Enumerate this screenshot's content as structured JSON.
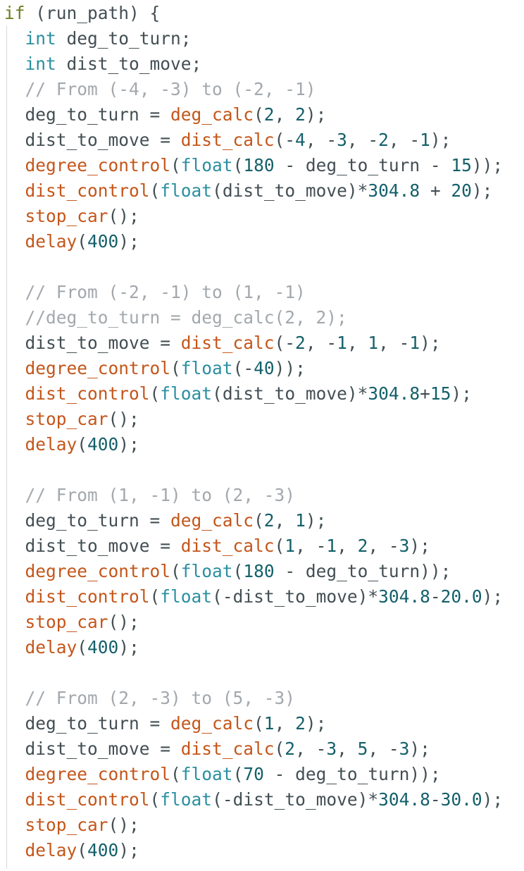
{
  "colors": {
    "keyword": "#6f7a1e",
    "type": "#2a8fa0",
    "function": "#c4561a",
    "number": "#14606a",
    "comment": "#a3a8ad",
    "identifier": "#434f54",
    "background": "#ffffff"
  },
  "lines": [
    {
      "tokens": [
        {
          "t": "if",
          "c": "kw"
        },
        {
          "t": " (run_path) {",
          "c": "id"
        }
      ]
    },
    {
      "tokens": [
        {
          "t": "  ",
          "c": "id"
        },
        {
          "t": "int",
          "c": "type"
        },
        {
          "t": " deg_to_turn;",
          "c": "id"
        }
      ]
    },
    {
      "tokens": [
        {
          "t": "  ",
          "c": "id"
        },
        {
          "t": "int",
          "c": "type"
        },
        {
          "t": " dist_to_move;",
          "c": "id"
        }
      ]
    },
    {
      "tokens": [
        {
          "t": "  // From (-4, -3) to (-2, -1)",
          "c": "cmt"
        }
      ]
    },
    {
      "tokens": [
        {
          "t": "  deg_to_turn = ",
          "c": "id"
        },
        {
          "t": "deg_calc",
          "c": "fn"
        },
        {
          "t": "(",
          "c": "id"
        },
        {
          "t": "2",
          "c": "num"
        },
        {
          "t": ", ",
          "c": "id"
        },
        {
          "t": "2",
          "c": "num"
        },
        {
          "t": ");",
          "c": "id"
        }
      ]
    },
    {
      "tokens": [
        {
          "t": "  dist_to_move = ",
          "c": "id"
        },
        {
          "t": "dist_calc",
          "c": "fn"
        },
        {
          "t": "(-",
          "c": "id"
        },
        {
          "t": "4",
          "c": "num"
        },
        {
          "t": ", -",
          "c": "id"
        },
        {
          "t": "3",
          "c": "num"
        },
        {
          "t": ", -",
          "c": "id"
        },
        {
          "t": "2",
          "c": "num"
        },
        {
          "t": ", -",
          "c": "id"
        },
        {
          "t": "1",
          "c": "num"
        },
        {
          "t": ");",
          "c": "id"
        }
      ]
    },
    {
      "tokens": [
        {
          "t": "  ",
          "c": "id"
        },
        {
          "t": "degree_control",
          "c": "fn"
        },
        {
          "t": "(",
          "c": "id"
        },
        {
          "t": "float",
          "c": "type"
        },
        {
          "t": "(",
          "c": "id"
        },
        {
          "t": "180",
          "c": "num"
        },
        {
          "t": " - deg_to_turn - ",
          "c": "id"
        },
        {
          "t": "15",
          "c": "num"
        },
        {
          "t": "));",
          "c": "id"
        }
      ]
    },
    {
      "tokens": [
        {
          "t": "  ",
          "c": "id"
        },
        {
          "t": "dist_control",
          "c": "fn"
        },
        {
          "t": "(",
          "c": "id"
        },
        {
          "t": "float",
          "c": "type"
        },
        {
          "t": "(dist_to_move)*",
          "c": "id"
        },
        {
          "t": "304.8",
          "c": "num"
        },
        {
          "t": " + ",
          "c": "id"
        },
        {
          "t": "20",
          "c": "num"
        },
        {
          "t": ");",
          "c": "id"
        }
      ]
    },
    {
      "tokens": [
        {
          "t": "  ",
          "c": "id"
        },
        {
          "t": "stop_car",
          "c": "fn"
        },
        {
          "t": "();",
          "c": "id"
        }
      ]
    },
    {
      "tokens": [
        {
          "t": "  ",
          "c": "id"
        },
        {
          "t": "delay",
          "c": "fn"
        },
        {
          "t": "(",
          "c": "id"
        },
        {
          "t": "400",
          "c": "num"
        },
        {
          "t": ");",
          "c": "id"
        }
      ]
    },
    {
      "tokens": []
    },
    {
      "tokens": [
        {
          "t": "  // From (-2, -1) to (1, -1)",
          "c": "cmt"
        }
      ]
    },
    {
      "tokens": [
        {
          "t": "  //deg_to_turn = deg_calc(2, 2);",
          "c": "cmt"
        }
      ]
    },
    {
      "tokens": [
        {
          "t": "  dist_to_move = ",
          "c": "id"
        },
        {
          "t": "dist_calc",
          "c": "fn"
        },
        {
          "t": "(-",
          "c": "id"
        },
        {
          "t": "2",
          "c": "num"
        },
        {
          "t": ", -",
          "c": "id"
        },
        {
          "t": "1",
          "c": "num"
        },
        {
          "t": ", ",
          "c": "id"
        },
        {
          "t": "1",
          "c": "num"
        },
        {
          "t": ", -",
          "c": "id"
        },
        {
          "t": "1",
          "c": "num"
        },
        {
          "t": ");",
          "c": "id"
        }
      ]
    },
    {
      "tokens": [
        {
          "t": "  ",
          "c": "id"
        },
        {
          "t": "degree_control",
          "c": "fn"
        },
        {
          "t": "(",
          "c": "id"
        },
        {
          "t": "float",
          "c": "type"
        },
        {
          "t": "(-",
          "c": "id"
        },
        {
          "t": "40",
          "c": "num"
        },
        {
          "t": "));",
          "c": "id"
        }
      ]
    },
    {
      "tokens": [
        {
          "t": "  ",
          "c": "id"
        },
        {
          "t": "dist_control",
          "c": "fn"
        },
        {
          "t": "(",
          "c": "id"
        },
        {
          "t": "float",
          "c": "type"
        },
        {
          "t": "(dist_to_move)*",
          "c": "id"
        },
        {
          "t": "304.8",
          "c": "num"
        },
        {
          "t": "+",
          "c": "id"
        },
        {
          "t": "15",
          "c": "num"
        },
        {
          "t": ");",
          "c": "id"
        }
      ]
    },
    {
      "tokens": [
        {
          "t": "  ",
          "c": "id"
        },
        {
          "t": "stop_car",
          "c": "fn"
        },
        {
          "t": "();",
          "c": "id"
        }
      ]
    },
    {
      "tokens": [
        {
          "t": "  ",
          "c": "id"
        },
        {
          "t": "delay",
          "c": "fn"
        },
        {
          "t": "(",
          "c": "id"
        },
        {
          "t": "400",
          "c": "num"
        },
        {
          "t": ");",
          "c": "id"
        }
      ]
    },
    {
      "tokens": []
    },
    {
      "tokens": [
        {
          "t": "  // From (1, -1) to (2, -3)",
          "c": "cmt"
        }
      ]
    },
    {
      "tokens": [
        {
          "t": "  deg_to_turn = ",
          "c": "id"
        },
        {
          "t": "deg_calc",
          "c": "fn"
        },
        {
          "t": "(",
          "c": "id"
        },
        {
          "t": "2",
          "c": "num"
        },
        {
          "t": ", ",
          "c": "id"
        },
        {
          "t": "1",
          "c": "num"
        },
        {
          "t": ");",
          "c": "id"
        }
      ]
    },
    {
      "tokens": [
        {
          "t": "  dist_to_move = ",
          "c": "id"
        },
        {
          "t": "dist_calc",
          "c": "fn"
        },
        {
          "t": "(",
          "c": "id"
        },
        {
          "t": "1",
          "c": "num"
        },
        {
          "t": ", -",
          "c": "id"
        },
        {
          "t": "1",
          "c": "num"
        },
        {
          "t": ", ",
          "c": "id"
        },
        {
          "t": "2",
          "c": "num"
        },
        {
          "t": ", -",
          "c": "id"
        },
        {
          "t": "3",
          "c": "num"
        },
        {
          "t": ");",
          "c": "id"
        }
      ]
    },
    {
      "tokens": [
        {
          "t": "  ",
          "c": "id"
        },
        {
          "t": "degree_control",
          "c": "fn"
        },
        {
          "t": "(",
          "c": "id"
        },
        {
          "t": "float",
          "c": "type"
        },
        {
          "t": "(",
          "c": "id"
        },
        {
          "t": "180",
          "c": "num"
        },
        {
          "t": " - deg_to_turn));",
          "c": "id"
        }
      ]
    },
    {
      "tokens": [
        {
          "t": "  ",
          "c": "id"
        },
        {
          "t": "dist_control",
          "c": "fn"
        },
        {
          "t": "(",
          "c": "id"
        },
        {
          "t": "float",
          "c": "type"
        },
        {
          "t": "(-dist_to_move)*",
          "c": "id"
        },
        {
          "t": "304.8",
          "c": "num"
        },
        {
          "t": "-",
          "c": "id"
        },
        {
          "t": "20.0",
          "c": "num"
        },
        {
          "t": ");",
          "c": "id"
        }
      ]
    },
    {
      "tokens": [
        {
          "t": "  ",
          "c": "id"
        },
        {
          "t": "stop_car",
          "c": "fn"
        },
        {
          "t": "();",
          "c": "id"
        }
      ]
    },
    {
      "tokens": [
        {
          "t": "  ",
          "c": "id"
        },
        {
          "t": "delay",
          "c": "fn"
        },
        {
          "t": "(",
          "c": "id"
        },
        {
          "t": "400",
          "c": "num"
        },
        {
          "t": ");",
          "c": "id"
        }
      ]
    },
    {
      "tokens": []
    },
    {
      "tokens": [
        {
          "t": "  // From (2, -3) to (5, -3)",
          "c": "cmt"
        }
      ]
    },
    {
      "tokens": [
        {
          "t": "  deg_to_turn = ",
          "c": "id"
        },
        {
          "t": "deg_calc",
          "c": "fn"
        },
        {
          "t": "(",
          "c": "id"
        },
        {
          "t": "1",
          "c": "num"
        },
        {
          "t": ", ",
          "c": "id"
        },
        {
          "t": "2",
          "c": "num"
        },
        {
          "t": ");",
          "c": "id"
        }
      ]
    },
    {
      "tokens": [
        {
          "t": "  dist_to_move = ",
          "c": "id"
        },
        {
          "t": "dist_calc",
          "c": "fn"
        },
        {
          "t": "(",
          "c": "id"
        },
        {
          "t": "2",
          "c": "num"
        },
        {
          "t": ", -",
          "c": "id"
        },
        {
          "t": "3",
          "c": "num"
        },
        {
          "t": ", ",
          "c": "id"
        },
        {
          "t": "5",
          "c": "num"
        },
        {
          "t": ", -",
          "c": "id"
        },
        {
          "t": "3",
          "c": "num"
        },
        {
          "t": ");",
          "c": "id"
        }
      ]
    },
    {
      "tokens": [
        {
          "t": "  ",
          "c": "id"
        },
        {
          "t": "degree_control",
          "c": "fn"
        },
        {
          "t": "(",
          "c": "id"
        },
        {
          "t": "float",
          "c": "type"
        },
        {
          "t": "(",
          "c": "id"
        },
        {
          "t": "70",
          "c": "num"
        },
        {
          "t": " - deg_to_turn));",
          "c": "id"
        }
      ]
    },
    {
      "tokens": [
        {
          "t": "  ",
          "c": "id"
        },
        {
          "t": "dist_control",
          "c": "fn"
        },
        {
          "t": "(",
          "c": "id"
        },
        {
          "t": "float",
          "c": "type"
        },
        {
          "t": "(-dist_to_move)*",
          "c": "id"
        },
        {
          "t": "304.8",
          "c": "num"
        },
        {
          "t": "-",
          "c": "id"
        },
        {
          "t": "30.0",
          "c": "num"
        },
        {
          "t": ");",
          "c": "id"
        }
      ]
    },
    {
      "tokens": [
        {
          "t": "  ",
          "c": "id"
        },
        {
          "t": "stop_car",
          "c": "fn"
        },
        {
          "t": "();",
          "c": "id"
        }
      ]
    },
    {
      "tokens": [
        {
          "t": "  ",
          "c": "id"
        },
        {
          "t": "delay",
          "c": "fn"
        },
        {
          "t": "(",
          "c": "id"
        },
        {
          "t": "400",
          "c": "num"
        },
        {
          "t": ");",
          "c": "id"
        }
      ]
    }
  ]
}
